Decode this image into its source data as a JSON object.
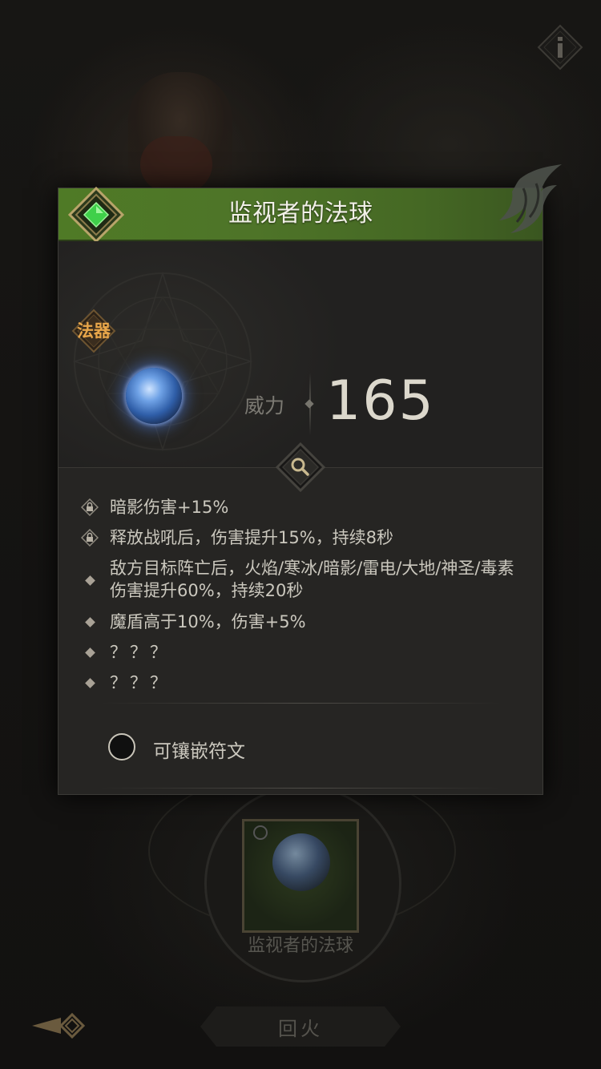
{
  "item": {
    "title": "监视者的法球",
    "category": "法器",
    "power_label": "威力",
    "power_value": "165",
    "rarity_color": "#4f7a26"
  },
  "stats": [
    {
      "icon": "lock-icon",
      "text": "暗影伤害+15%"
    },
    {
      "icon": "lock-icon",
      "text": "释放战吼后，伤害提升15%，持续8秒"
    },
    {
      "icon": "diamond-bullet",
      "text": "敌方目标阵亡后，火焰/寒冰/暗影/雷电/大地/神圣/毒素伤害提升60%，持续20秒"
    },
    {
      "icon": "diamond-bullet",
      "text": "魔盾高于10%，伤害+5%"
    },
    {
      "icon": "diamond-bullet",
      "text": "？？？"
    },
    {
      "icon": "diamond-bullet",
      "text": "？？？"
    }
  ],
  "socket": {
    "label": "可镶嵌符文"
  },
  "background": {
    "equipped_item_name": "监视者的法球",
    "action_button_label": "回火"
  }
}
